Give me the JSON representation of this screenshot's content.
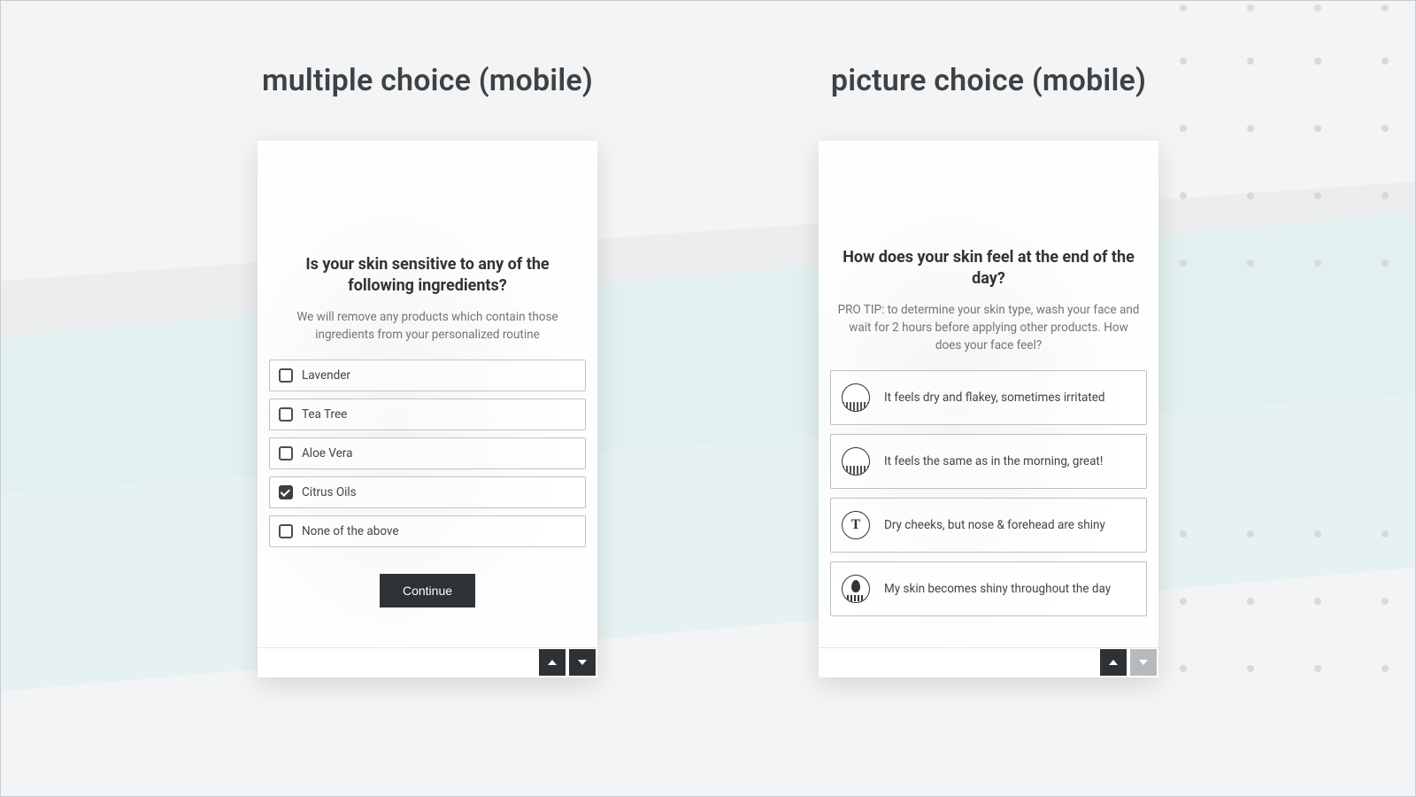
{
  "left": {
    "heading": "multiple choice (mobile)",
    "question": "Is your skin sensitive to any of the following ingredients?",
    "subtext": "We will remove any products which contain those ingredients from your personalized routine",
    "options": [
      {
        "label": "Lavender",
        "checked": false
      },
      {
        "label": "Tea Tree",
        "checked": false
      },
      {
        "label": "Aloe Vera",
        "checked": false
      },
      {
        "label": "Citrus Oils",
        "checked": true
      },
      {
        "label": "None of the above",
        "checked": false
      }
    ],
    "continue_label": "Continue",
    "nav_down_disabled": false
  },
  "right": {
    "heading": "picture choice (mobile)",
    "question": "How does your skin feel at the end of the day?",
    "subtext": "PRO TIP: to determine your skin type, wash your face and wait for 2 hours before applying other products. How does your face feel?",
    "options": [
      {
        "label": "It feels dry and flakey, sometimes irritated",
        "icon": "dry-skin-icon"
      },
      {
        "label": "It feels the same as in the morning, great!",
        "icon": "normal-skin-icon"
      },
      {
        "label": "Dry cheeks, but nose & forehead are shiny",
        "icon": "tzone-icon"
      },
      {
        "label": "My skin becomes shiny throughout the day",
        "icon": "oily-skin-icon"
      }
    ],
    "nav_down_disabled": true
  }
}
